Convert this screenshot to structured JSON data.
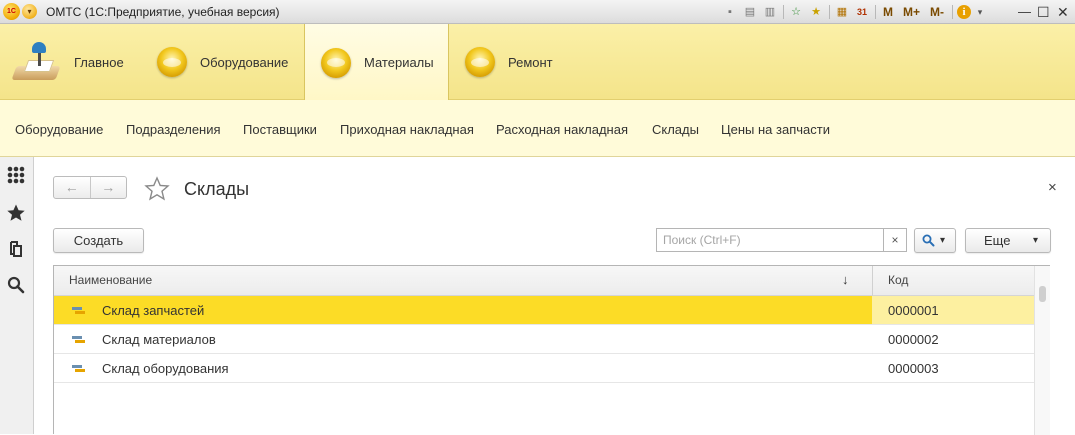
{
  "window": {
    "title": "ОМТС  (1С:Предприятие, учебная версия)",
    "logo_text": "1С",
    "toolbar_text_buttons": [
      "M",
      "M+",
      "M-"
    ]
  },
  "sections": [
    {
      "label": "Главное",
      "active": false,
      "icon": "desk-lamp-icon"
    },
    {
      "label": "Оборудование",
      "active": false,
      "icon": "yellow-circle-icon"
    },
    {
      "label": "Материалы",
      "active": true,
      "icon": "yellow-circle-icon"
    },
    {
      "label": "Ремонт",
      "active": false,
      "icon": "yellow-circle-icon"
    }
  ],
  "functions": [
    "Оборудование",
    "Подразделения",
    "Поставщики",
    "Приходная накладная",
    "Расходная накладная",
    "Склады",
    "Цены на запчасти"
  ],
  "page": {
    "title": "Склады",
    "back_glyph": "←",
    "forward_glyph": "→",
    "close_glyph": "×"
  },
  "commands": {
    "create_label": "Создать",
    "search_placeholder": "Поиск (Ctrl+F)",
    "search_clear_glyph": "×",
    "more_label": "Еще",
    "more_arrow": "▾",
    "search_button_arrow": "▾"
  },
  "table": {
    "columns": [
      "Наименование",
      "Код"
    ],
    "sort_indicator": "↓",
    "rows": [
      {
        "name": "Склад запчастей",
        "code": "0000001",
        "selected": true
      },
      {
        "name": "Склад материалов",
        "code": "0000002",
        "selected": false
      },
      {
        "name": "Склад оборудования",
        "code": "0000003",
        "selected": false
      }
    ]
  },
  "colors": {
    "section_panel": "#f4e48a",
    "function_panel": "#fffbd9",
    "selected_row_name": "#fcdc26",
    "selected_row_code": "#fdf0a0"
  }
}
